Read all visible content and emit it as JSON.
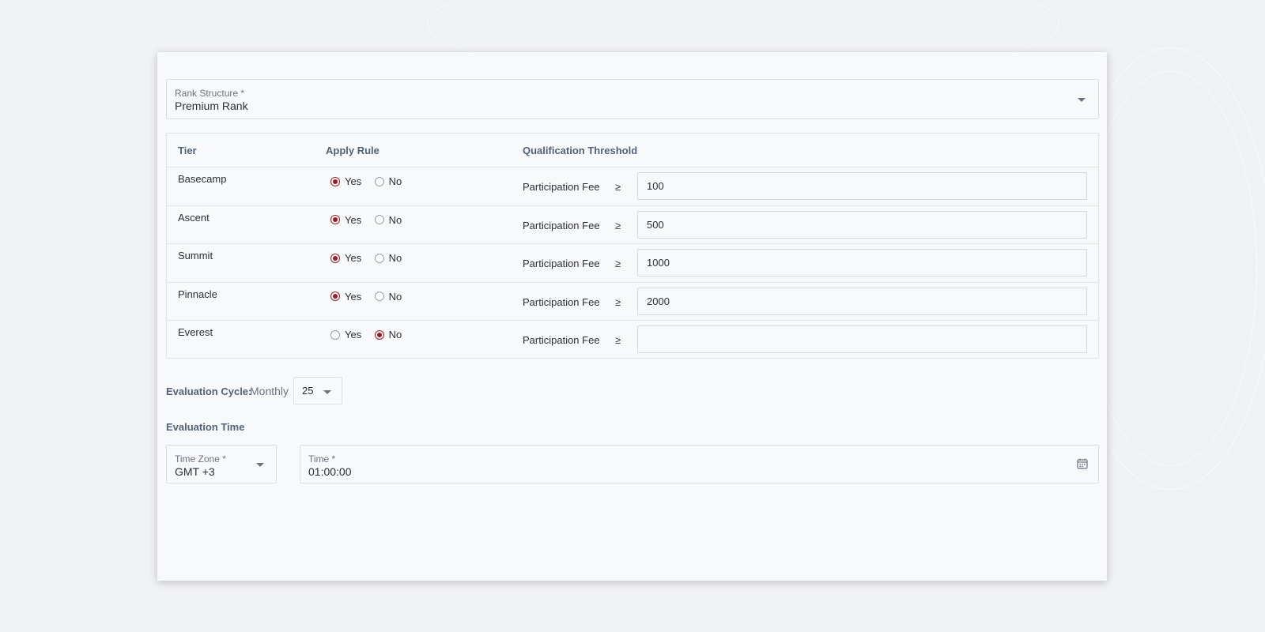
{
  "rank_structure": {
    "label": "Rank Structure *",
    "value": "Premium Rank"
  },
  "table": {
    "headers": {
      "tier": "Tier",
      "apply_rule": "Apply Rule",
      "threshold": "Qualification Threshold"
    },
    "yes_label": "Yes",
    "no_label": "No",
    "fee_label": "Participation Fee",
    "operator": "≥",
    "rows": [
      {
        "tier": "Basecamp",
        "apply": "yes",
        "fee": "100"
      },
      {
        "tier": "Ascent",
        "apply": "yes",
        "fee": "500"
      },
      {
        "tier": "Summit",
        "apply": "yes",
        "fee": "1000"
      },
      {
        "tier": "Pinnacle",
        "apply": "yes",
        "fee": "2000"
      },
      {
        "tier": "Everest",
        "apply": "no",
        "fee": ""
      }
    ]
  },
  "evaluation_cycle": {
    "label": "Evaluation Cycle:",
    "period": "Monthly",
    "day": "25"
  },
  "evaluation_time": {
    "title": "Evaluation Time",
    "timezone_label": "Time Zone *",
    "timezone_value": "GMT +3",
    "time_label": "Time *",
    "time_value": "01:00:00"
  },
  "colors": {
    "accent": "#9b1c24",
    "header_text": "#52627a"
  },
  "icons": {
    "dropdown": "chevron-down-icon",
    "time_picker": "calendar-icon"
  }
}
